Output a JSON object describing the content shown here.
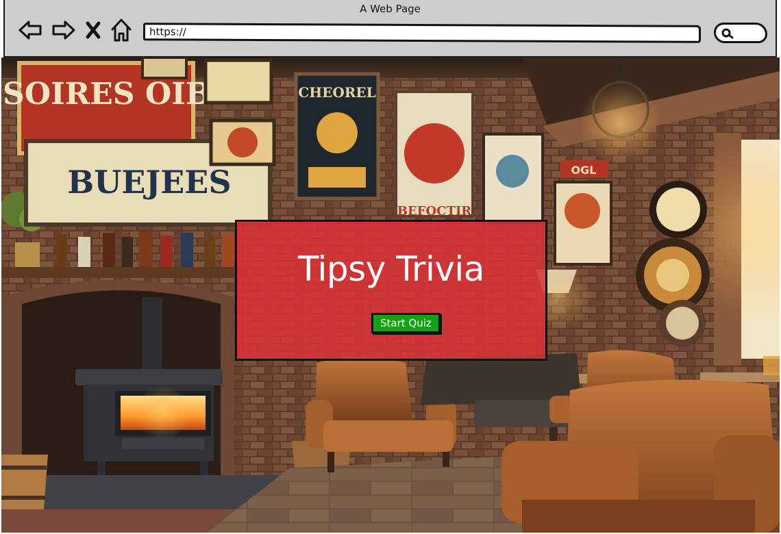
{
  "window": {
    "title": "A Web Page"
  },
  "toolbar": {
    "address_value": "https://",
    "icons": [
      "back-arrow-icon",
      "forward-arrow-icon",
      "close-x-icon",
      "home-icon",
      "search-icon"
    ]
  },
  "hero": {
    "title": "Tipsy Trivia",
    "start_label": "Start Quiz",
    "panel_color": "#dc3237",
    "button_color": "#12a314"
  },
  "scene": {
    "signs": [
      "SOIRES OIB",
      "BUEJEES",
      "CHEOREL",
      "BEFOCTIR",
      "OGL"
    ]
  }
}
